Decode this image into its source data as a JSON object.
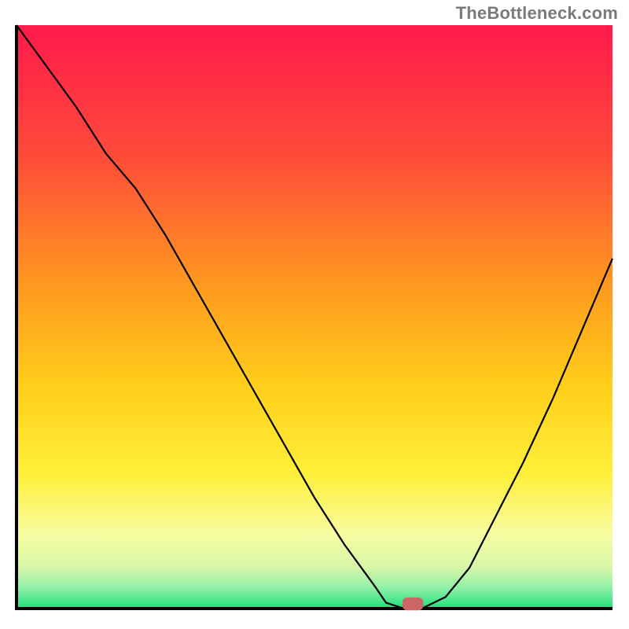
{
  "attribution": "TheBottleneck.com",
  "chart_data": {
    "type": "line",
    "title": "",
    "xlabel": "",
    "ylabel": "",
    "xlim": [
      0,
      100
    ],
    "ylim": [
      0,
      100
    ],
    "x": [
      0,
      5,
      10,
      15,
      20,
      25,
      30,
      35,
      40,
      45,
      50,
      55,
      60,
      62,
      65,
      68,
      72,
      76,
      80,
      85,
      90,
      95,
      100
    ],
    "values": [
      100,
      93,
      86,
      78,
      72,
      64,
      55,
      46,
      37,
      28,
      19,
      11,
      4,
      1,
      0,
      0,
      2,
      7,
      15,
      25,
      36,
      48,
      60
    ],
    "marker": {
      "x": 66.5,
      "y": 0.8,
      "w": 3.5,
      "h": 2.2
    },
    "annotations": []
  }
}
